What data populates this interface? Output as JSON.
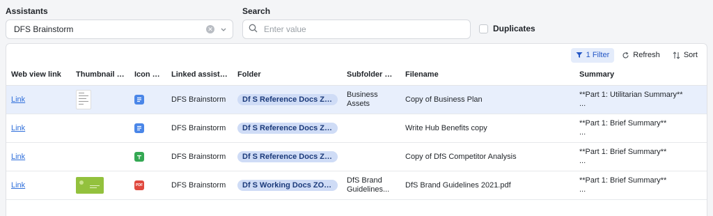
{
  "filters": {
    "assistants_label": "Assistants",
    "assistants_value": "DFS Brainstorm",
    "search_label": "Search",
    "search_placeholder": "Enter value",
    "duplicates_label": "Duplicates"
  },
  "toolbar": {
    "filter_label": "1 Filter",
    "refresh_label": "Refresh",
    "sort_label": "Sort"
  },
  "columns": [
    "Web view link",
    "Thumbnail b...",
    "Icon li...",
    "Linked assista...",
    "Folder",
    "Subfolder na...",
    "Filename",
    "Summary"
  ],
  "rows": [
    {
      "link": "Link",
      "thumbnail": "doc-thumbnail",
      "icon": "google-doc-icon",
      "assistant": "DFS Brainstorm",
      "folder": "Df S Reference Docs ZOHO",
      "subfolder_line1": "Business",
      "subfolder_line2": "Assets",
      "filename": "Copy of Business Plan",
      "summary_line1": "**Part 1: Utilitarian Summary**",
      "summary_line2": "..."
    },
    {
      "link": "Link",
      "thumbnail": "",
      "icon": "google-doc-icon",
      "assistant": "DFS Brainstorm",
      "folder": "Df S Reference Docs ZOHO",
      "subfolder_line1": "",
      "subfolder_line2": "",
      "filename": "Write Hub Benefits copy",
      "summary_line1": "**Part 1: Brief Summary**",
      "summary_line2": "..."
    },
    {
      "link": "Link",
      "thumbnail": "",
      "icon": "google-sheet-icon",
      "assistant": "DFS Brainstorm",
      "folder": "Df S Reference Docs ZOHO",
      "subfolder_line1": "",
      "subfolder_line2": "",
      "filename": "Copy of DfS Competitor Analysis",
      "summary_line1": "**Part 1: Brief Summary**",
      "summary_line2": "..."
    },
    {
      "link": "Link",
      "thumbnail": "brand-guidelines-thumbnail",
      "icon": "pdf-icon",
      "icon_text": "PDF",
      "assistant": "DFS Brainstorm",
      "folder": "Df S Working Docs ZOHO",
      "subfolder_line1": "DfS Brand",
      "subfolder_line2": "Guidelines...",
      "filename": "DfS Brand Guidelines 2021.pdf",
      "summary_line1": "**Part 1: Brief Summary**",
      "summary_line2": "..."
    }
  ],
  "colors": {
    "accent": "#2457c5",
    "selected_row": "#e8effc",
    "pill_bg": "#cfdcf6",
    "doc_icon": "#4a86e8",
    "sheet_icon": "#34a853",
    "pdf_icon": "#e0483e"
  }
}
